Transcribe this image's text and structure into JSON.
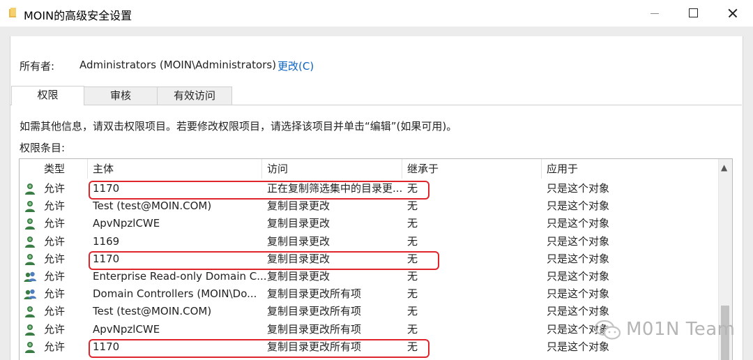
{
  "window": {
    "title": "MOIN的高级安全设置",
    "controls": {
      "minimize": "minimize",
      "maximize": "maximize",
      "close": "close"
    }
  },
  "owner": {
    "label": "所有者:",
    "value": "Administrators (MOIN\\Administrators)",
    "change_link": "更改(C)"
  },
  "tabs": [
    {
      "label": "权限",
      "active": true
    },
    {
      "label": "审核",
      "active": false
    },
    {
      "label": "有效访问",
      "active": false
    }
  ],
  "info_text": "如需其他信息，请双击权限项目。若要修改权限项目，请选择该项目并单击“编辑”(如果可用)。",
  "entries_label": "权限条目:",
  "table": {
    "columns": [
      "类型",
      "主体",
      "访问",
      "继承于",
      "应用于"
    ],
    "rows": [
      {
        "icon": "user-icon",
        "type": "允许",
        "principal": "1170",
        "access": "正在复制筛选集中的目录更...",
        "inherited": "无",
        "applies_to": "只是这个对象",
        "highlighted": true
      },
      {
        "icon": "user-icon",
        "type": "允许",
        "principal": "Test (test@MOIN.COM)",
        "access": "复制目录更改",
        "inherited": "无",
        "applies_to": "只是这个对象",
        "highlighted": false
      },
      {
        "icon": "user-icon",
        "type": "允许",
        "principal": "ApvNpzlCWE",
        "access": "复制目录更改",
        "inherited": "无",
        "applies_to": "只是这个对象",
        "highlighted": false
      },
      {
        "icon": "user-icon",
        "type": "允许",
        "principal": "1169",
        "access": "复制目录更改",
        "inherited": "无",
        "applies_to": "只是这个对象",
        "highlighted": false
      },
      {
        "icon": "user-icon",
        "type": "允许",
        "principal": "1170",
        "access": "复制目录更改",
        "inherited": "无",
        "applies_to": "只是这个对象",
        "highlighted": true
      },
      {
        "icon": "group-icon",
        "type": "允许",
        "principal": "Enterprise Read-only Domain C...",
        "access": "复制目录更改",
        "inherited": "无",
        "applies_to": "只是这个对象",
        "highlighted": false
      },
      {
        "icon": "group-icon",
        "type": "允许",
        "principal": "Domain Controllers (MOIN\\Do...",
        "access": "复制目录更改所有项",
        "inherited": "无",
        "applies_to": "只是这个对象",
        "highlighted": false
      },
      {
        "icon": "user-icon",
        "type": "允许",
        "principal": "Test (test@MOIN.COM)",
        "access": "复制目录更改所有项",
        "inherited": "无",
        "applies_to": "只是这个对象",
        "highlighted": false
      },
      {
        "icon": "user-icon",
        "type": "允许",
        "principal": "ApvNpzlCWE",
        "access": "复制目录更改所有项",
        "inherited": "无",
        "applies_to": "只是这个对象",
        "highlighted": false
      },
      {
        "icon": "user-icon",
        "type": "允许",
        "principal": "1170",
        "access": "复制目录更改所有项",
        "inherited": "无",
        "applies_to": "只是这个对象",
        "highlighted": true
      }
    ]
  },
  "watermark": {
    "text": "M01N Team"
  },
  "colors": {
    "link": "#0b63c1",
    "highlight": "#e0242c",
    "user_icon": "#3a7d44"
  }
}
